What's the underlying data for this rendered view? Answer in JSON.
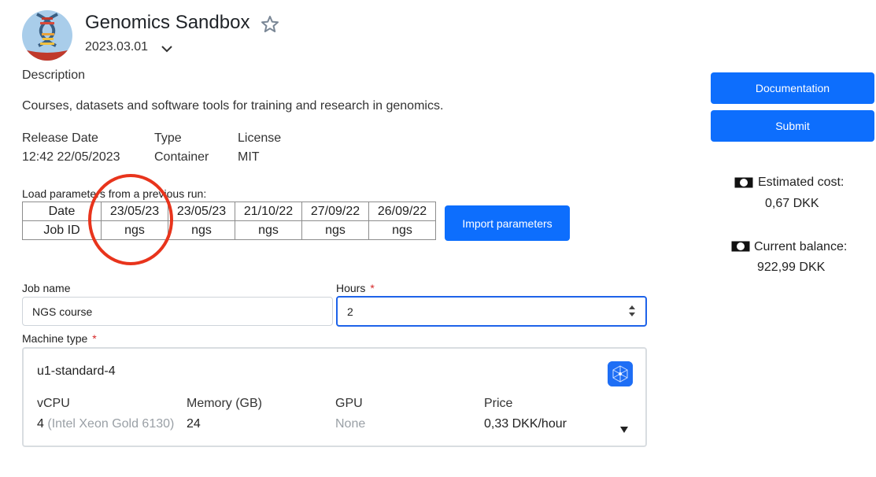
{
  "app": {
    "title": "Genomics Sandbox",
    "version": "2023.03.01"
  },
  "description": {
    "heading": "Description",
    "text": "Courses, datasets and software tools for training and research in genomics."
  },
  "meta": {
    "release_label": "Release Date",
    "release_value": "12:42 22/05/2023",
    "type_label": "Type",
    "type_value": "Container",
    "license_label": "License",
    "license_value": "MIT"
  },
  "previous_runs": {
    "label": "Load parameters from a previous run:",
    "date_header": "Date",
    "jobid_header": "Job ID",
    "runs": [
      {
        "date": "23/05/23",
        "job_id": "ngs"
      },
      {
        "date": "23/05/23",
        "job_id": "ngs"
      },
      {
        "date": "21/10/22",
        "job_id": "ngs"
      },
      {
        "date": "27/09/22",
        "job_id": "ngs"
      },
      {
        "date": "26/09/22",
        "job_id": "ngs"
      }
    ],
    "import_label": "Import parameters"
  },
  "form": {
    "job_name_label": "Job name",
    "job_name_value": "NGS course",
    "hours_label": "Hours",
    "hours_value": "2",
    "required_mark": "*",
    "machine_type_label": "Machine type"
  },
  "machine": {
    "name": "u1-standard-4",
    "vcpu_label": "vCPU",
    "vcpu_value": "4",
    "vcpu_detail": "(Intel Xeon Gold 6130)",
    "memory_label": "Memory (GB)",
    "memory_value": "24",
    "gpu_label": "GPU",
    "gpu_value": "None",
    "price_label": "Price",
    "price_value": "0,33 DKK/hour"
  },
  "sidebar": {
    "documentation_label": "Documentation",
    "submit_label": "Submit",
    "estimated_cost_label": "Estimated cost:",
    "estimated_cost_value": "0,67 DKK",
    "balance_label": "Current balance:",
    "balance_value": "922,99 DKK"
  },
  "colors": {
    "primary": "#0d6efd",
    "highlight_circle": "#e8341c",
    "required": "#d62828"
  },
  "icons": [
    "dna-logo",
    "star-icon",
    "chevron-down-icon",
    "spinner-icon",
    "network-icon",
    "dropdown-arrow-icon",
    "money-icon"
  ]
}
